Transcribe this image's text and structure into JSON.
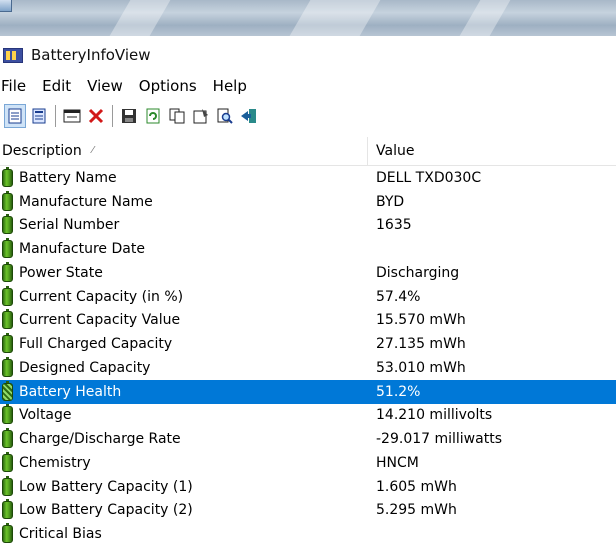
{
  "window": {
    "title": "BatteryInfoView"
  },
  "menu": [
    "File",
    "Edit",
    "View",
    "Options",
    "Help"
  ],
  "columns": {
    "description": "Description",
    "value": "Value"
  },
  "rows": [
    {
      "description": "Battery Name",
      "value": "DELL TXD030C"
    },
    {
      "description": "Manufacture Name",
      "value": "BYD"
    },
    {
      "description": "Serial Number",
      "value": "1635"
    },
    {
      "description": "Manufacture Date",
      "value": ""
    },
    {
      "description": "Power State",
      "value": "Discharging"
    },
    {
      "description": "Current Capacity (in %)",
      "value": "57.4%"
    },
    {
      "description": "Current Capacity Value",
      "value": "15.570 mWh"
    },
    {
      "description": "Full Charged Capacity",
      "value": "27.135 mWh"
    },
    {
      "description": "Designed Capacity",
      "value": "53.010 mWh"
    },
    {
      "description": "Battery Health",
      "value": "51.2%",
      "selected": true
    },
    {
      "description": "Voltage",
      "value": "14.210 millivolts"
    },
    {
      "description": "Charge/Discharge Rate",
      "value": "-29.017 milliwatts"
    },
    {
      "description": "Chemistry",
      "value": "HNCM"
    },
    {
      "description": "Low Battery Capacity (1)",
      "value": "1.605 mWh"
    },
    {
      "description": "Low Battery Capacity (2)",
      "value": "5.295 mWh"
    },
    {
      "description": "Critical Bias",
      "value": ""
    }
  ],
  "colors": {
    "selection": "#0078d7",
    "battery_icon": "#4d9a1c"
  }
}
